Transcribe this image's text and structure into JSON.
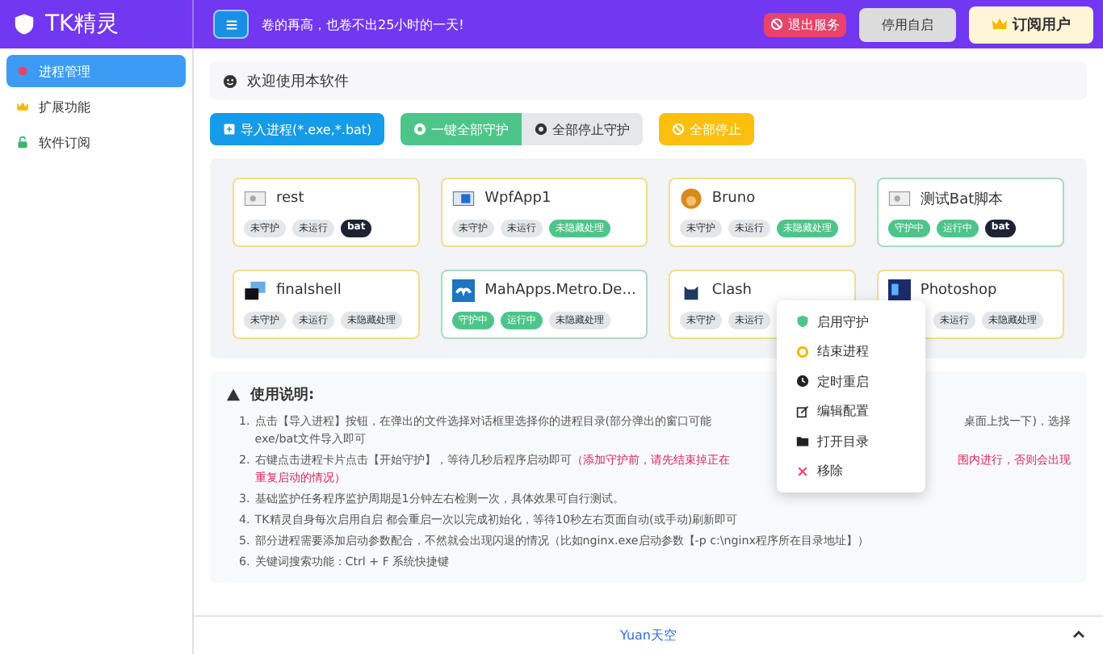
{
  "app": {
    "title": "TK精灵"
  },
  "header": {
    "slogan": "卷的再高，也卷不出25小时的一天!",
    "buttons": [
      {
        "kind": "danger",
        "label": "退出服务"
      },
      {
        "kind": "plain",
        "label": "停用自启"
      },
      {
        "kind": "premium",
        "label": "订阅用户"
      }
    ]
  },
  "sidebar": {
    "items": [
      {
        "label": "进程管理",
        "selected": true
      },
      {
        "label": "扩展功能",
        "selected": false
      },
      {
        "label": "软件订阅",
        "selected": false
      }
    ]
  },
  "welcome": "欢迎使用本软件",
  "toolbar": [
    {
      "kind": "primary",
      "label": "导入进程(*.exe,*.bat)"
    },
    {
      "kind": "success",
      "label": "一键全部守护"
    },
    {
      "kind": "secondary",
      "label": "全部停止守护"
    },
    {
      "kind": "warning",
      "label": "全部停止"
    }
  ],
  "processes": [
    {
      "name": "rest",
      "guarded": false,
      "tags": [
        {
          "kind": "grey",
          "text": "未守护"
        },
        {
          "kind": "grey",
          "text": "未运行"
        },
        {
          "kind": "dark",
          "text": "bat"
        }
      ]
    },
    {
      "name": "WpfApp1",
      "guarded": false,
      "tags": [
        {
          "kind": "grey",
          "text": "未守护"
        },
        {
          "kind": "grey",
          "text": "未运行"
        },
        {
          "kind": "green",
          "text": "未隐藏处理"
        }
      ]
    },
    {
      "name": "Bruno",
      "guarded": false,
      "tags": [
        {
          "kind": "grey",
          "text": "未守护"
        },
        {
          "kind": "grey",
          "text": "未运行"
        },
        {
          "kind": "green",
          "text": "未隐藏处理"
        }
      ]
    },
    {
      "name": "测试Bat脚本",
      "guarded": true,
      "tags": [
        {
          "kind": "green",
          "text": "守护中"
        },
        {
          "kind": "green",
          "text": "运行中"
        },
        {
          "kind": "dark",
          "text": "bat"
        }
      ]
    },
    {
      "name": "finalshell",
      "guarded": false,
      "tags": [
        {
          "kind": "grey",
          "text": "未守护"
        },
        {
          "kind": "grey",
          "text": "未运行"
        },
        {
          "kind": "grey",
          "text": "未隐藏处理"
        }
      ]
    },
    {
      "name": "MahApps.Metro.De...",
      "guarded": true,
      "tags": [
        {
          "kind": "green",
          "text": "守护中"
        },
        {
          "kind": "green",
          "text": "运行中"
        },
        {
          "kind": "grey",
          "text": "未隐藏处理"
        }
      ]
    },
    {
      "name": "Clash",
      "guarded": false,
      "tags": [
        {
          "kind": "grey",
          "text": "未守护"
        },
        {
          "kind": "grey",
          "text": "未运行"
        }
      ]
    },
    {
      "name": "Photoshop",
      "guarded": false,
      "tags": [
        {
          "kind": "covered"
        },
        {
          "kind": "grey",
          "text": "未运行"
        },
        {
          "kind": "grey",
          "text": "未隐藏处理"
        }
      ]
    }
  ],
  "context_menu": [
    {
      "label": "启用守护"
    },
    {
      "label": "结束进程"
    },
    {
      "label": "定时重启"
    },
    {
      "label": "编辑配置"
    },
    {
      "label": "打开目录"
    },
    {
      "label": "移除"
    }
  ],
  "instructions": {
    "title": "使用说明:",
    "items": [
      {
        "number": "1.",
        "lines": [
          [
            {
              "kind": "plain",
              "text": "点击【导入进程】按钮，在弹出的文件选择对话框里选择你的进程目录(部分弹出的窗口可能"
            },
            {
              "kind": "covered"
            },
            {
              "kind": "plain",
              "text": "桌面上找一下)，选择"
            }
          ],
          [
            {
              "kind": "plain",
              "text": "exe/bat文件导入即可"
            }
          ]
        ]
      },
      {
        "number": "2.",
        "lines": [
          [
            {
              "kind": "plain",
              "text": "右键点击进程卡片点击【开始守护】，等待几秒后程序启动即可"
            },
            {
              "kind": "warning",
              "text": "（添加守护前，请先结束掉正在"
            },
            {
              "kind": "covered"
            },
            {
              "kind": "warning",
              "text": "围内进行，否则会出现"
            }
          ],
          [
            {
              "kind": "warning",
              "text": "重复启动的情况）"
            }
          ]
        ]
      },
      {
        "number": "3.",
        "lines": [
          [
            {
              "kind": "plain",
              "text": "基础监护任务程序监护周期是1分钟左右检测一次，具体效果可自行测试。"
            }
          ]
        ]
      },
      {
        "number": "4.",
        "lines": [
          [
            {
              "kind": "plain",
              "text": "TK精灵自身每次启用自启 都会重启一次以完成初始化，等待10秒左右页面自动(或手动)刷新即可"
            }
          ]
        ]
      },
      {
        "number": "5.",
        "lines": [
          [
            {
              "kind": "plain",
              "text": "部分进程需要添加启动参数配合，不然就会出现闪退的情况（比如nginx.exe启动参数【-p c:\\nginx程序所在目录地址】）"
            }
          ]
        ]
      },
      {
        "number": "6.",
        "lines": [
          [
            {
              "kind": "plain",
              "text": "关键词搜索功能：Ctrl + F 系统快捷键"
            }
          ]
        ]
      }
    ]
  },
  "footer": {
    "link": "Yuan天空"
  }
}
